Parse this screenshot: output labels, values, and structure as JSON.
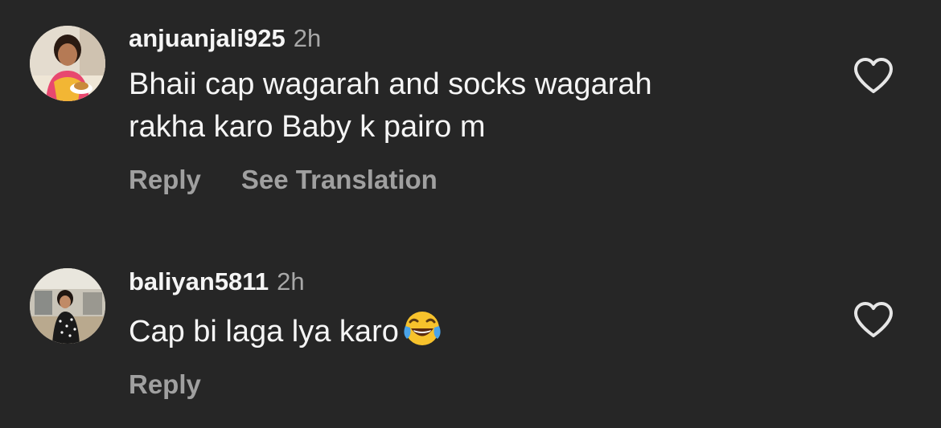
{
  "comments": [
    {
      "username": "anjuanjali925",
      "time": "2h",
      "text_lines": [
        "Bhaii cap wagarah and socks wagarah",
        "rakha karo Baby k pairo m"
      ],
      "actions": [
        "Reply",
        "See Translation"
      ],
      "avatar_icon": "user-photo-avatar",
      "like_icon": "heart-outline-icon"
    },
    {
      "username": "baliyan5811",
      "time": "2h",
      "text_lines": [
        "Cap bi laga lya karo"
      ],
      "emoji": "face-with-tears-of-joy-emoji",
      "actions": [
        "Reply"
      ],
      "avatar_icon": "user-photo-avatar",
      "like_icon": "heart-outline-icon"
    }
  ],
  "colors": {
    "background": "#262626",
    "primary_text": "#f5f5f5",
    "secondary_text": "#a8a8a8",
    "action_text": "#a0a0a0",
    "icon": "#e6e6e6"
  }
}
